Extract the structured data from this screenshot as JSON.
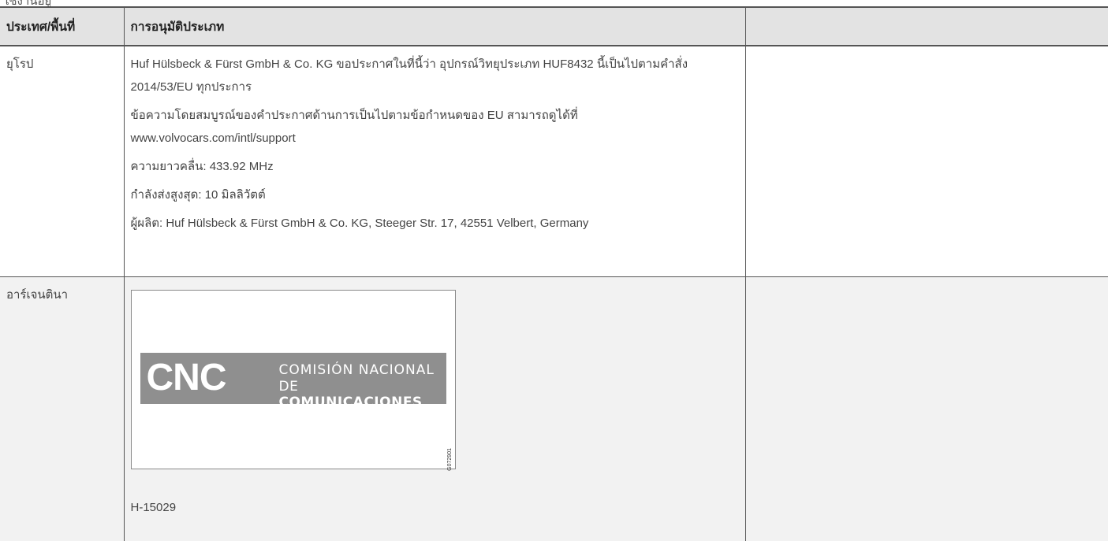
{
  "page_top_text": "ใช้งานอยู่",
  "table": {
    "headers": {
      "country": "ประเทศ/พื้นที่",
      "approval_type": "การอนุมัติประเภท",
      "extra": ""
    },
    "rows": [
      {
        "country": "ยุโรป",
        "paragraphs": [
          "Huf Hülsbeck & Fürst GmbH & Co. KG ขอประกาศในที่นี้ว่า อุปกรณ์วิทยุประเภท HUF8432 นี้เป็นไปตามคำสั่ง 2014/53/EU ทุกประการ",
          "ข้อความโดยสมบูรณ์ของคำประกาศด้านการเป็นไปตามข้อกำหนดของ EU สามารถดูได้ที่ www.volvocars.com/intl/support",
          "ความยาวคลื่น: 433.92 MHz",
          "กำลังส่งสูงสุด: 10 มิลลิวัตต์",
          "ผู้ผลิต: Huf Hülsbeck & Fürst GmbH & Co. KG, Steeger Str. 17, 42551 Velbert, Germany"
        ]
      },
      {
        "country": "อาร์เจนตินา",
        "logo": {
          "letters": "CNC",
          "name_line1": "COMISIÓN NACIONAL",
          "name_line2_prefix": "DE ",
          "name_line2_bold": "COMUNICACIONES",
          "image_code": "G072901"
        },
        "approval_code": "H-15029"
      }
    ]
  }
}
